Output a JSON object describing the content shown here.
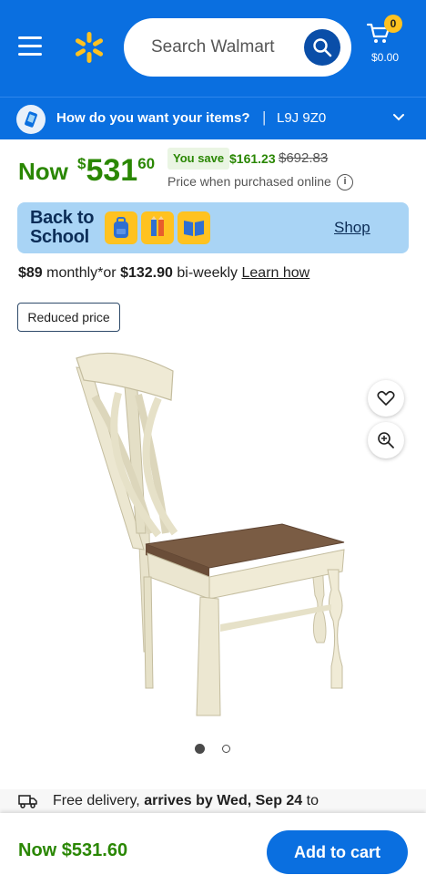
{
  "header": {
    "menu_icon": "hamburger-menu-icon",
    "logo_icon": "walmart-spark-logo",
    "search_placeholder": "Search Walmart",
    "search_icon": "search-icon",
    "cart_icon": "cart-icon",
    "cart_count": "0",
    "cart_total": "$0.00",
    "brand_color": "#0a6fe0",
    "spark_color": "#ffc220"
  },
  "delivery_bar": {
    "icon": "phone-delivery-icon",
    "question": "How do you want your items?",
    "separator": "|",
    "zip": "L9J 9Z0",
    "chevron": "chevron-down-icon"
  },
  "price": {
    "now_label": "Now",
    "currency": "$",
    "dollars": "531",
    "cents": "60",
    "save_label": "You save",
    "save_amount": "$161.23",
    "was_price": "$692.83",
    "note": "Price when purchased online",
    "info_icon": "info-icon",
    "accent": "#2a8703"
  },
  "promo": {
    "title_line1": "Back to",
    "title_line2": "School",
    "icons": [
      "backpack-icon",
      "pencil-icon",
      "book-icon"
    ],
    "shop_label": "Shop",
    "bg_color": "#a9d4f5"
  },
  "financing": {
    "monthly": "$89",
    "monthly_text": " monthly*or ",
    "biweekly": "$132.90",
    "biweekly_text": " bi-weekly ",
    "learn_label": "Learn how"
  },
  "tag": {
    "label": "Reduced price"
  },
  "product": {
    "image_icon": "dining-chair-image",
    "favorite_icon": "heart-icon",
    "zoom_icon": "zoom-in-icon",
    "carousel_current": 1,
    "carousel_total": 2
  },
  "shipping": {
    "truck_icon": "truck-icon",
    "text_pre": "Free delivery, ",
    "arrives": "arrives by Wed, Sep 24",
    "text_post": " to"
  },
  "bottom_bar": {
    "price": "Now $531.60",
    "add_label": "Add to cart"
  }
}
